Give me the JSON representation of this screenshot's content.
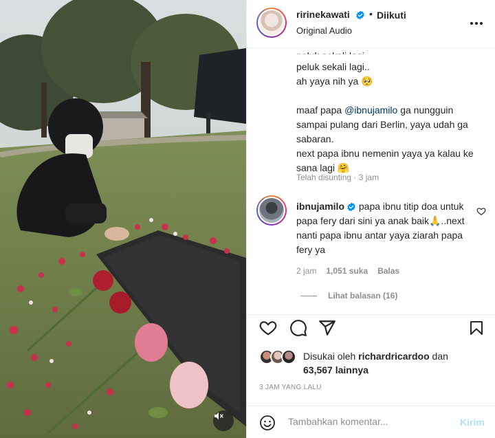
{
  "post": {
    "owner_username": "ririnekawati",
    "dot": "•",
    "follow_state": "Diikuti",
    "audio_label": "Original Audio",
    "caption_lines": [
      "peluk sekali lagi..",
      "ah yaya nih ya 🥺",
      "",
      "maaf papa ",
      "sampai pulang dari Berlin, yaya udah ga",
      "sabaran.",
      "next papa ibnu nemenin yaya ya kalau ke",
      "sana lagi 🤗"
    ],
    "caption_cut_line": "peluk sekali lagi",
    "caption_mention": "@ibnujamilo",
    "caption_after_mention": " ga nungguin",
    "edited_meta": "Telah disunting · 3 jam"
  },
  "reply": {
    "username": "ibnujamilo",
    "text": " papa ibnu titip doa untuk papa fery dari sini ya anak baik🙏..next nanti papa ibnu antar yaya ziarah papa fery ya",
    "time": "2 jam",
    "likes": "1,051 suka",
    "reply_label": "Balas",
    "view_replies": "Lihat balasan (16)"
  },
  "engagement": {
    "liked_prefix": "Disukai oleh ",
    "liked_user": "richardricardoo",
    "liked_join": " dan",
    "liked_others": "63,567 lainnya",
    "time_ago": "3 JAM YANG LALU"
  },
  "composer": {
    "placeholder": "Tambahkan komentar...",
    "send_label": "Kirim"
  },
  "icons": {
    "like": "heart-icon",
    "comment": "comment-bubble-icon",
    "share": "paper-plane-icon",
    "save": "bookmark-icon",
    "more": "ellipsis-icon",
    "emoji": "smiley-icon",
    "mute": "speaker-muted-icon",
    "verified": "verified-badge-icon"
  },
  "colors": {
    "text": "#262626",
    "secondary": "#8e8e8e",
    "link": "#00376b",
    "verified": "#0095f6",
    "send_disabled": "#b2dffc",
    "divider": "#efefef"
  }
}
